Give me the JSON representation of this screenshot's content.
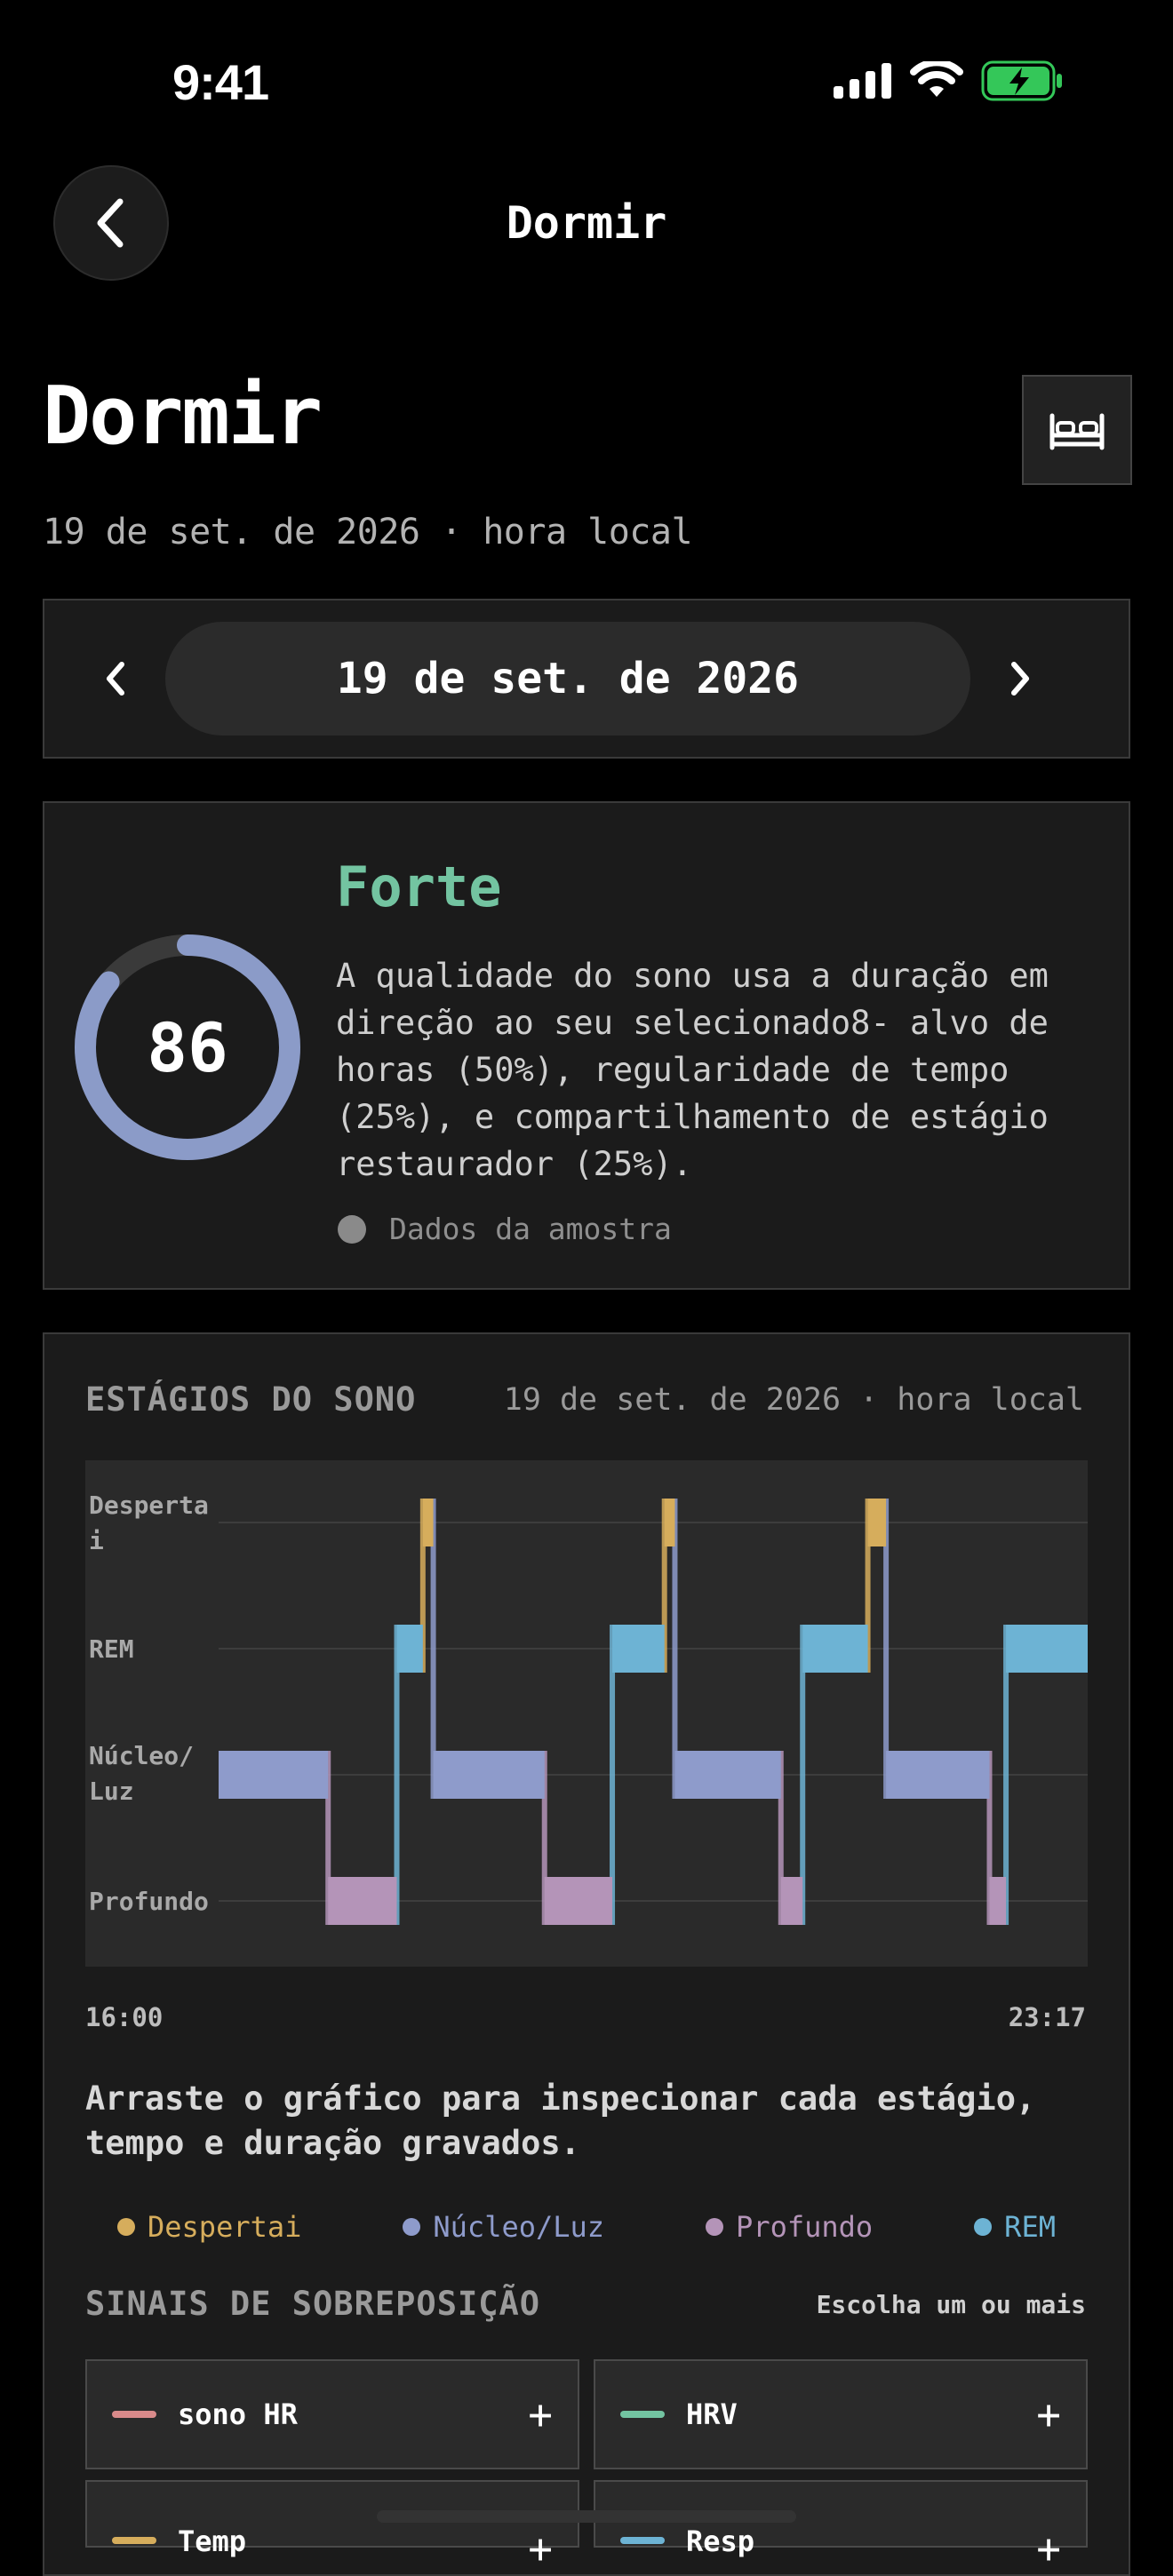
{
  "status_bar": {
    "time": "9:41"
  },
  "nav": {
    "title": "Dormir"
  },
  "header": {
    "title": "Dormir",
    "subtitle": "19 de set. de 2026 · hora local"
  },
  "date_selector": {
    "value": "19 de set. de 2026"
  },
  "score": {
    "value": "86",
    "fraction": 0.86,
    "label": "Forte",
    "description": "A qualidade do sono usa a duração em direção ao seu selecionado8- alvo de horas (50%), regularidade de tempo (25%), e compartilhamento de estágio restaurador (25%).",
    "sample_note": "Dados da amostra",
    "ring_color": "#8b9bc8"
  },
  "stages": {
    "title": "ESTÁGIOS DO SONO",
    "date": "19 de set. de 2026 · hora local",
    "axis_start": "16:00",
    "axis_end": "23:17",
    "hint": "Arraste o gráfico para inspecionar cada estágio, tempo e duração gravados."
  },
  "chart_data": {
    "type": "step",
    "levels": [
      "Despertai",
      "REM",
      "Núcleo/Luz",
      "Profundo"
    ],
    "level_labels": [
      "Despertai",
      "REM",
      "Núcleo/ Luz",
      "Profundo"
    ],
    "x_range": [
      "16:00",
      "23:17"
    ],
    "colors": {
      "Despertai": "#d6ad5c",
      "REM": "#6db3d4",
      "Núcleo/Luz": "#8e9bcb",
      "Profundo": "#b494b8"
    },
    "segments": [
      {
        "stage": "Núcleo/Luz",
        "start": 0.0,
        "end": 0.126
      },
      {
        "stage": "Profundo",
        "start": 0.126,
        "end": 0.205
      },
      {
        "stage": "REM",
        "start": 0.205,
        "end": 0.235
      },
      {
        "stage": "Despertai",
        "start": 0.235,
        "end": 0.247
      },
      {
        "stage": "Núcleo/Luz",
        "start": 0.247,
        "end": 0.375
      },
      {
        "stage": "Profundo",
        "start": 0.375,
        "end": 0.453
      },
      {
        "stage": "REM",
        "start": 0.453,
        "end": 0.513
      },
      {
        "stage": "Despertai",
        "start": 0.513,
        "end": 0.525
      },
      {
        "stage": "Núcleo/Luz",
        "start": 0.525,
        "end": 0.647
      },
      {
        "stage": "Profundo",
        "start": 0.647,
        "end": 0.672
      },
      {
        "stage": "REM",
        "start": 0.672,
        "end": 0.747
      },
      {
        "stage": "Despertai",
        "start": 0.747,
        "end": 0.768
      },
      {
        "stage": "Núcleo/Luz",
        "start": 0.768,
        "end": 0.887
      },
      {
        "stage": "Profundo",
        "start": 0.887,
        "end": 0.906
      },
      {
        "stage": "REM",
        "start": 0.906,
        "end": 1.0
      }
    ]
  },
  "legend": [
    {
      "label": "Despertai",
      "color": "#d6ad5c"
    },
    {
      "label": "Núcleo/Luz",
      "color": "#8e9bcb"
    },
    {
      "label": "Profundo",
      "color": "#b494b8"
    },
    {
      "label": "REM",
      "color": "#6db3d4"
    }
  ],
  "overlay": {
    "title": "SINAIS DE SOBREPOSIÇÃO",
    "hint": "Escolha um ou mais",
    "signals": [
      {
        "label": "sono HR",
        "color": "#d98a8a",
        "action": "+"
      },
      {
        "label": "HRV",
        "color": "#73c4a1",
        "action": "+"
      },
      {
        "label": "Temp",
        "color": "#d6ad5c",
        "action": "+"
      },
      {
        "label": "Resp",
        "color": "#6db3d4",
        "action": "+"
      }
    ]
  }
}
